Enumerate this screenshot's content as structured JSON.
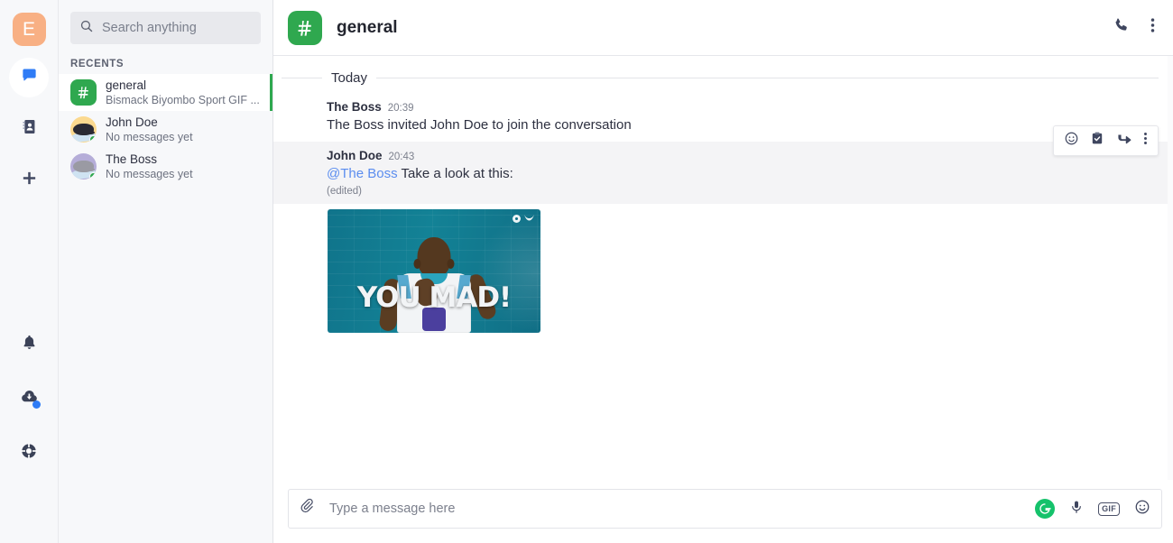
{
  "app": {
    "logo_letter": "E",
    "accent_green": "#2fa84f",
    "accent_blue": "#2f7cf6",
    "logo_bg": "#f8b084"
  },
  "rail": {
    "items": [
      {
        "name": "chat-icon",
        "label": "Chat",
        "active": true
      },
      {
        "name": "contacts-icon",
        "label": "Contacts",
        "active": false
      },
      {
        "name": "add-icon",
        "label": "Add",
        "active": false
      }
    ],
    "bottom_items": [
      {
        "name": "bell-icon",
        "label": "Notifications",
        "badge": false
      },
      {
        "name": "cloud-download-icon",
        "label": "Downloads",
        "badge": true
      },
      {
        "name": "lifebuoy-icon",
        "label": "Help",
        "badge": false
      },
      {
        "name": "user-avatar",
        "label": "Profile",
        "badge": false
      }
    ]
  },
  "search": {
    "placeholder": "Search anything",
    "icon": "search-icon",
    "value": ""
  },
  "sidebar": {
    "section_label": "RECENTS",
    "conversations": [
      {
        "name": "general",
        "preview": "Bismack Biyombo Sport GIF ...",
        "type": "channel",
        "icon": "hash-icon",
        "selected": true,
        "online": false
      },
      {
        "name": "John Doe",
        "preview": "No messages yet",
        "type": "direct",
        "icon": "cat-avatar-yellow",
        "selected": false,
        "online": true
      },
      {
        "name": "The Boss",
        "preview": "No messages yet",
        "type": "direct",
        "icon": "cat-avatar-lavender",
        "selected": false,
        "online": true
      }
    ]
  },
  "chat_header": {
    "icon": "hash-icon",
    "title": "general",
    "actions": [
      {
        "name": "call-icon",
        "label": "Call"
      },
      {
        "name": "kebab-menu-icon",
        "label": "More options"
      }
    ]
  },
  "messages": {
    "day_divider": "Today",
    "items": [
      {
        "author": "The Boss",
        "time": "20:39",
        "text": "The Boss invited John Doe to join the conversation",
        "avatar": "cat-avatar-lavender",
        "hovered": false,
        "edited": "",
        "mention": ""
      },
      {
        "author": "John Doe",
        "time": "20:43",
        "mention": "@The Boss",
        "text": "Take a look at this:",
        "avatar": "cat-avatar-yellow",
        "hovered": true,
        "edited": "(edited)"
      }
    ],
    "hover_actions": [
      {
        "name": "emoji-react-icon",
        "label": "Add reaction"
      },
      {
        "name": "clipboard-check-icon",
        "label": "Create task"
      },
      {
        "name": "forward-icon",
        "label": "Forward"
      },
      {
        "name": "kebab-menu-icon",
        "label": "More actions"
      }
    ],
    "attachment": {
      "type": "gif",
      "caption": "YOU MAD!",
      "alt": "Bismack Biyombo Sport GIF",
      "width": "236",
      "height": "137",
      "bg_color": "#10748b"
    }
  },
  "composer": {
    "placeholder": "Type a message here",
    "value": "",
    "attach_icon": "paperclip-icon",
    "right_actions": [
      {
        "name": "grammarly-icon",
        "label": "G"
      },
      {
        "name": "microphone-icon",
        "label": "Voice message"
      },
      {
        "name": "gif-icon",
        "label": "GIF"
      },
      {
        "name": "emoji-icon",
        "label": "Emoji"
      }
    ]
  }
}
